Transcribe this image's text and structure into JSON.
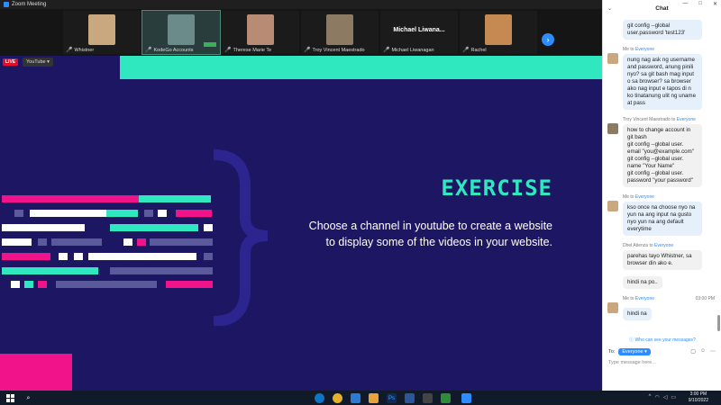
{
  "window": {
    "title": "Zoom Meeting"
  },
  "participants": [
    {
      "name": "Whistner",
      "face_color": "#c9a77f"
    },
    {
      "name": "KodeGo Accounts",
      "face_color": "#6b8a8a"
    },
    {
      "name": "Therese Marie Te",
      "face_color": "#b88c74"
    },
    {
      "name": "Troy Vincent Maestrado",
      "face_color": "#8c7a63"
    },
    {
      "name": "Michael Liwanagan",
      "display": "Michael  Liwana..."
    },
    {
      "name": "Rachel",
      "face_color": "#c58a52"
    }
  ],
  "share": {
    "live_label": "LIVE",
    "platform": "YouTube",
    "title": "EXERCISE",
    "subtitle": "Choose a channel in youtube to create a website to display some of the videos in your website.",
    "colors": {
      "bg": "#1d1763",
      "teal": "#2fe8c0",
      "pink": "#f0138a",
      "white": "#ffffff",
      "slate": "#5a5a9a"
    }
  },
  "chat": {
    "title": "Chat",
    "messages": [
      {
        "sender": "",
        "to": "",
        "time": "",
        "lines": [
          "git config --global user.password 'test123'"
        ],
        "style": "blue"
      },
      {
        "sender": "Me",
        "to": "Everyone",
        "time": "",
        "lines": [
          "nung nag ask ng username and password, anung pinili nyo? sa git bash mag input o sa browser? sa browser ako nag input e tapos di n ko tinatanung ulit ng uname at pass"
        ],
        "style": "blue"
      },
      {
        "sender": "Troy Vincent Maestrado",
        "to": "Everyone",
        "time": "",
        "lines": [
          "how to change account in git bash\ngit config --global user. email \"you@example.com\"\ngit config --global user. name \"Your Name\"\ngit config --global user. password \"your password\""
        ],
        "style": "gray"
      },
      {
        "sender": "Me",
        "to": "Everyone",
        "time": "",
        "lines": [
          "kso once na choose nyo na yun na ang input na gusto nyo yun na ang default everytime"
        ],
        "style": "blue"
      },
      {
        "sender": "Dhel Atienza",
        "to": "Everyone",
        "time": "",
        "lines": [
          "parehas tayo Whistner, sa browser din ako e.",
          "hindi na po.."
        ],
        "style": "gray"
      },
      {
        "sender": "Me",
        "to": "Everyone",
        "time": "03:00 PM",
        "lines": [
          "hindi na"
        ],
        "style": "blue"
      }
    ],
    "who_can_see": "Who can see your messages?",
    "to_label": "To:",
    "recipient": "Everyone",
    "placeholder": "Type message here..."
  },
  "taskbar": {
    "time": "3:00 PM",
    "date": "9/10/2022"
  }
}
